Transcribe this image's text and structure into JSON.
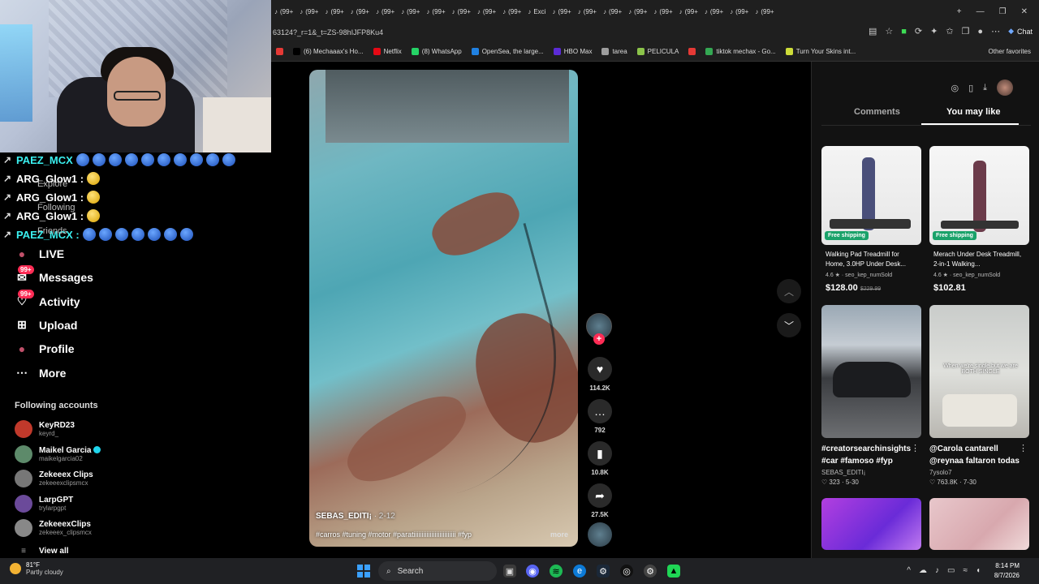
{
  "chat": [
    {
      "user": "PAEZ_MCX",
      "teal": true,
      "emotes": [
        "blue",
        "blue",
        "blue",
        "blue",
        "blue",
        "blue",
        "blue",
        "blue",
        "blue",
        "blue"
      ]
    },
    {
      "user": "ARG_Glow1 :",
      "teal": false,
      "emotes": [
        "yellow"
      ]
    },
    {
      "user": "ARG_Glow1 :",
      "teal": false,
      "emotes": [
        "yellow"
      ]
    },
    {
      "user": "ARG_Glow1 :",
      "teal": false,
      "emotes": [
        "yellow"
      ]
    },
    {
      "user": "PAEZ_MCX :",
      "teal": true,
      "emotes": [
        "blue",
        "blue",
        "blue",
        "blue",
        "blue",
        "blue",
        "blue"
      ]
    }
  ],
  "sidebar": {
    "faded": [
      "Explore",
      "Following",
      "Friends"
    ],
    "items": [
      {
        "label": "LIVE",
        "icon": "live-icon",
        "badge": ""
      },
      {
        "label": "Messages",
        "icon": "messages-icon",
        "badge": "99+"
      },
      {
        "label": "Activity",
        "icon": "activity-icon",
        "badge": "99+"
      },
      {
        "label": "Upload",
        "icon": "upload-icon",
        "badge": ""
      },
      {
        "label": "Profile",
        "icon": "profile-icon",
        "badge": ""
      },
      {
        "label": "More",
        "icon": "more-icon",
        "badge": ""
      }
    ],
    "following_title": "Following accounts",
    "accounts": [
      {
        "name": "KeyRD23",
        "handle": "keyrd_",
        "verified": false,
        "color": "#c0392b"
      },
      {
        "name": "Maikel Garcia",
        "handle": "maikelgarcia02",
        "verified": true,
        "color": "#5d8a6a"
      },
      {
        "name": "Zekeeex Clips",
        "handle": "zekeeexclipsmcx",
        "verified": false,
        "color": "#777"
      },
      {
        "name": "LarpGPT",
        "handle": "trylarpgpt",
        "verified": false,
        "color": "#6b4a9a"
      },
      {
        "name": "ZekeeexClips",
        "handle": "zekeeex_clipsmcx",
        "verified": false,
        "color": "#888"
      }
    ],
    "view_all": "View all"
  },
  "browser": {
    "tab_label": "(99+",
    "tab_excerpt": "Exci",
    "url": "63124?_r=1&_t=ZS-98hIJFP8Ku4",
    "chat_label": "Chat",
    "bookmarks": [
      {
        "label": "",
        "color": "#e53935"
      },
      {
        "label": "(6) Mechaaax's Ho...",
        "color": "#000000"
      },
      {
        "label": "Netflix",
        "color": "#e50914"
      },
      {
        "label": "(8) WhatsApp",
        "color": "#25d366"
      },
      {
        "label": "OpenSea, the large...",
        "color": "#2081e2"
      },
      {
        "label": "HBO Max",
        "color": "#5b2bd6"
      },
      {
        "label": "tarea",
        "color": "#9e9e9e"
      },
      {
        "label": "PELICULA",
        "color": "#8bc34a"
      },
      {
        "label": "",
        "color": "#e53935"
      },
      {
        "label": "tiktok mechax - Go...",
        "color": "#34a853"
      },
      {
        "label": "Turn Your Skins int...",
        "color": "#cddc39"
      }
    ],
    "other_favorites": "Other favorites"
  },
  "video": {
    "author": "SEBAS_EDITI¡",
    "date": "· 2-12",
    "caption": "#carros #tuning #motor #paratiiiiiiiiiiiiiiiiiiiiiiiiii #fyp",
    "more": "more",
    "likes": "114.2K",
    "comments": "792",
    "saves": "10.8K",
    "shares": "27.5K"
  },
  "right_panel": {
    "tabs": [
      "Comments",
      "You may like"
    ],
    "products": [
      {
        "title": "Walking Pad Treadmill for Home, 3.0HP Under Desk...",
        "rating": "4.6 ★ · seo_kep_numSold",
        "price": "$128.00",
        "old_price": "$229.99",
        "shipping": "Free shipping"
      },
      {
        "title": "Merach Under Desk Treadmill, 2-in-1 Walking...",
        "rating": "4.6 ★ · seo_kep_numSold",
        "price": "$102.81",
        "old_price": "",
        "shipping": "Free shipping"
      }
    ],
    "videos": [
      {
        "title": "#creatorsearchinsights #car #famoso #fyp",
        "author": "SEBAS_EDITI¡",
        "stats": "♡ 323 · 5-30",
        "overlay": ""
      },
      {
        "title": "@Carola cantarell @reynaa faltaron todas",
        "author": "7ysolo7",
        "stats": "♡ 763.8K · 7-30",
        "overlay": "When we're single but we are BOTH SINGLE"
      }
    ]
  },
  "taskbar": {
    "temp": "81°F",
    "weather": "Partly cloudy",
    "search": "Search",
    "time": "8:14 PM",
    "date": "8/7/2026"
  }
}
